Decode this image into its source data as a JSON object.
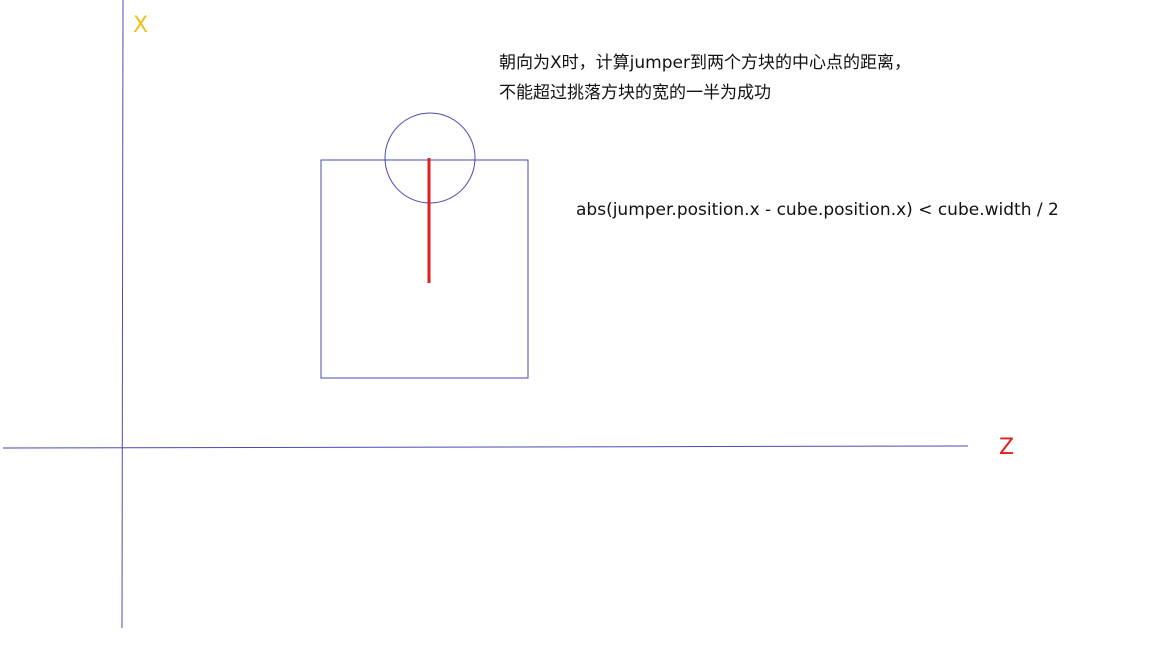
{
  "axes": {
    "vertical_label": "X",
    "horizontal_label": "Z"
  },
  "note": {
    "line1": "朝向为X时，计算jumper到两个方块的中心点的距离，",
    "line2": "不能超过挑落方块的宽的一半为成功"
  },
  "formula": "abs(jumper.position.x - cube.position.x) < cube.width / 2",
  "colors": {
    "axis_line": "#4a4ab8",
    "shape_stroke": "#4a4ab8",
    "distance_marker": "#e02020",
    "x_label": "#f0c020",
    "z_label": "#e02020",
    "text": "#111111"
  }
}
